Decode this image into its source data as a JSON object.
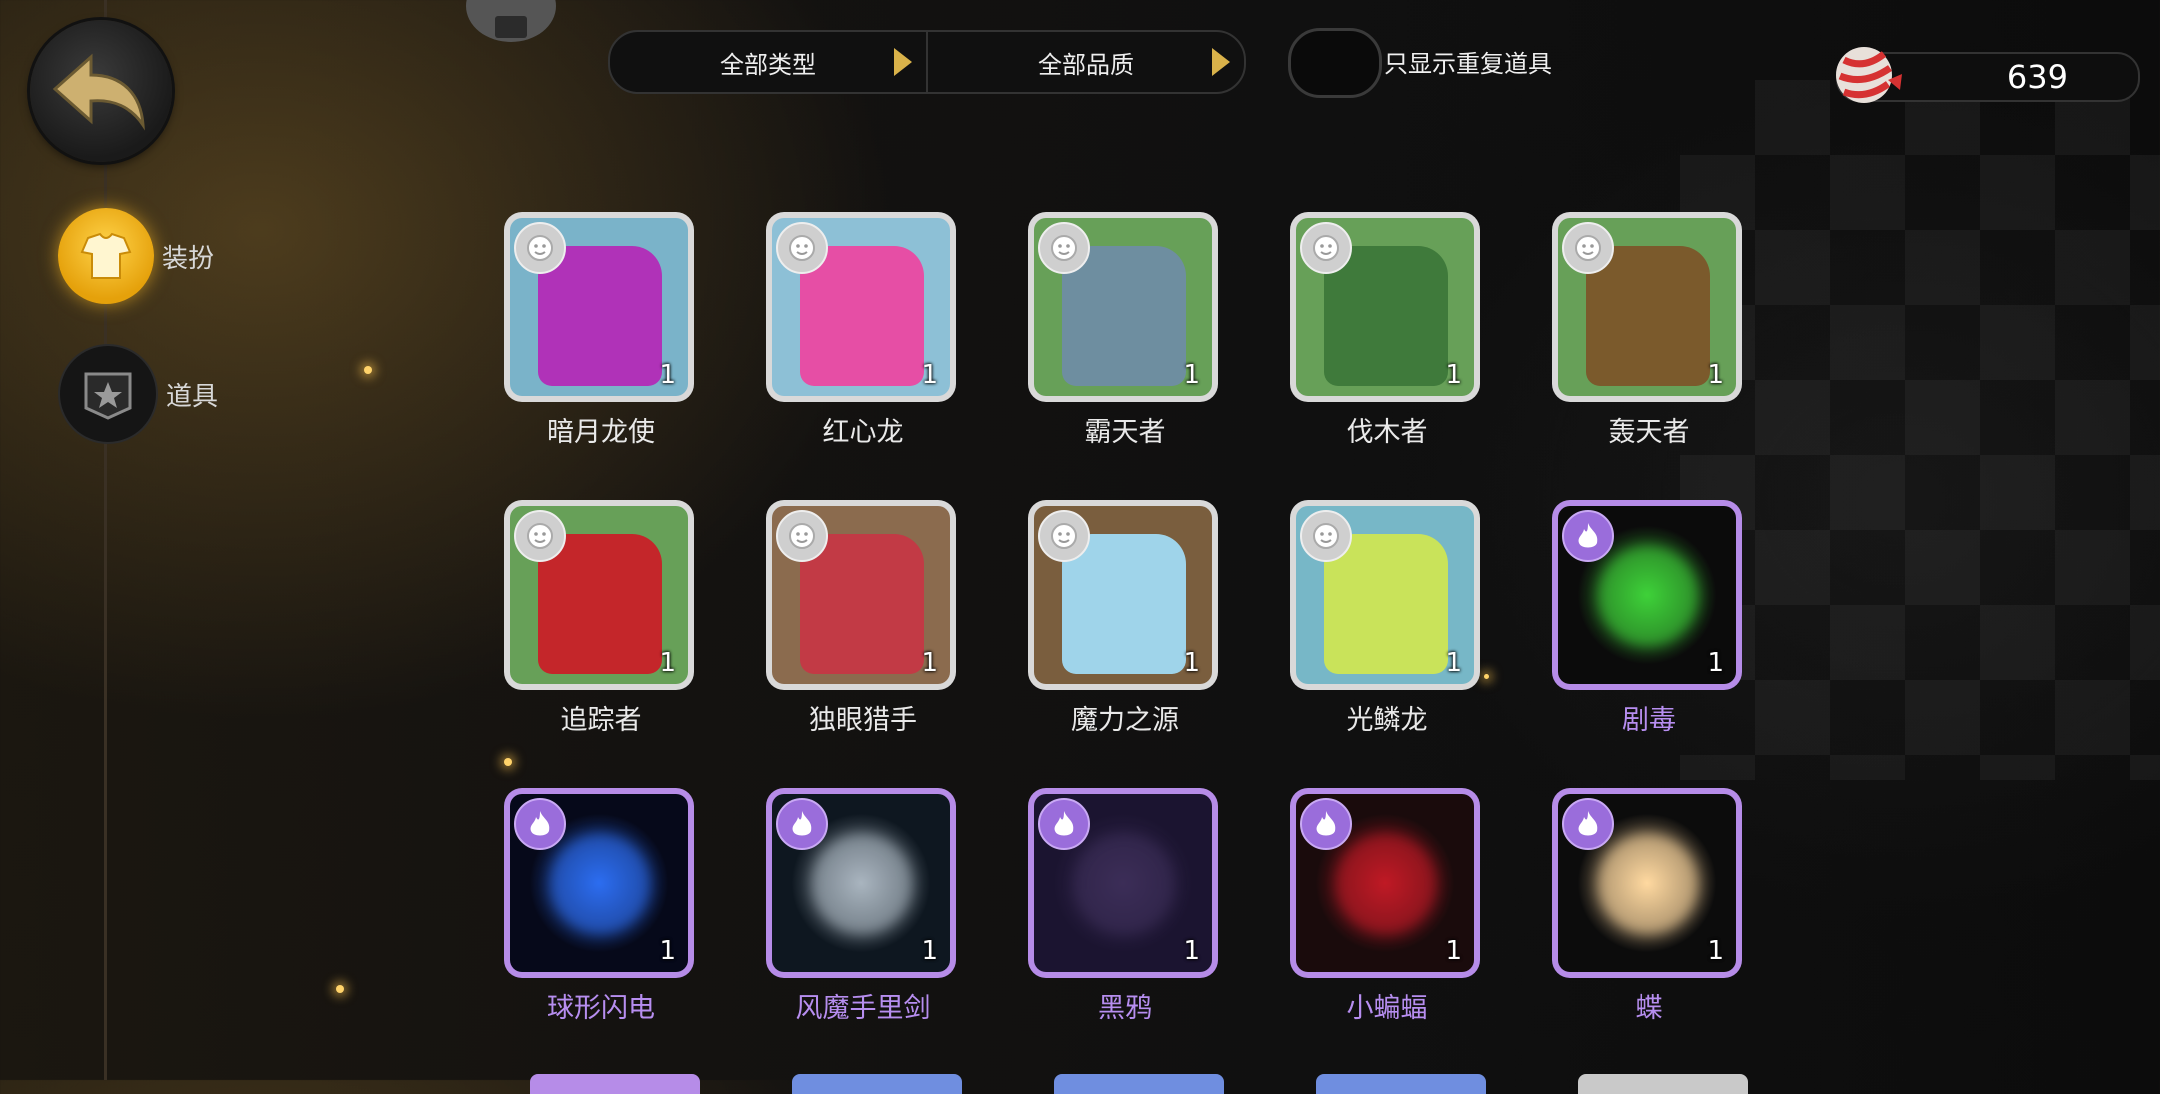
{
  "filters": {
    "type_label": "全部类型",
    "quality_label": "全部品质"
  },
  "toggle": {
    "label": "只显示重复道具",
    "on": false
  },
  "currency": {
    "value": "639",
    "icon": "candy-icon"
  },
  "nav": [
    {
      "label": "装扮",
      "icon": "shirt-icon",
      "active": true
    },
    {
      "label": "道具",
      "icon": "item-badge-icon",
      "active": false
    }
  ],
  "colors": {
    "epic": "#b68ce8",
    "common": "#d9d9d9",
    "accent": "#e5a10b"
  },
  "items": [
    {
      "name": "暗月龙使",
      "count": "1",
      "rarity": "common",
      "bg": "#7ab3c9",
      "art": "#b032b8"
    },
    {
      "name": "红心龙",
      "count": "1",
      "rarity": "common",
      "bg": "#8dc0d6",
      "art": "#e64ea5"
    },
    {
      "name": "霸天者",
      "count": "1",
      "rarity": "common",
      "bg": "#67a058",
      "art": "#6e8ea0"
    },
    {
      "name": "伐木者",
      "count": "1",
      "rarity": "common",
      "bg": "#67a058",
      "art": "#3f7a3b"
    },
    {
      "name": "轰天者",
      "count": "1",
      "rarity": "common",
      "bg": "#67a058",
      "art": "#7b5a2c"
    },
    {
      "name": "追踪者",
      "count": "1",
      "rarity": "common",
      "bg": "#67a058",
      "art": "#c4262a"
    },
    {
      "name": "独眼猎手",
      "count": "1",
      "rarity": "common",
      "bg": "#8b6b4e",
      "art": "#c23a45"
    },
    {
      "name": "魔力之源",
      "count": "1",
      "rarity": "common",
      "bg": "#7a5e3e",
      "art": "#9fd4ea"
    },
    {
      "name": "光鳞龙",
      "count": "1",
      "rarity": "common",
      "bg": "#77b7c7",
      "art": "#c9e35a"
    },
    {
      "name": "剧毒",
      "count": "1",
      "rarity": "epic",
      "bg": "#0b0b0b",
      "art": "#3fd13a"
    },
    {
      "name": "球形闪电",
      "count": "1",
      "rarity": "epic",
      "bg": "#06091a",
      "art": "#2d6df0"
    },
    {
      "name": "风魔手里剑",
      "count": "1",
      "rarity": "epic",
      "bg": "#0e1720",
      "art": "#a9b5bf"
    },
    {
      "name": "黑鸦",
      "count": "1",
      "rarity": "epic",
      "bg": "#1b1430",
      "art": "#3c2e58"
    },
    {
      "name": "小蝙蝠",
      "count": "1",
      "rarity": "epic",
      "bg": "#1a0b0c",
      "art": "#c01a26"
    },
    {
      "name": "蝶",
      "count": "1",
      "rarity": "epic",
      "bg": "#0c0c0c",
      "art": "#ffd9a0"
    }
  ]
}
